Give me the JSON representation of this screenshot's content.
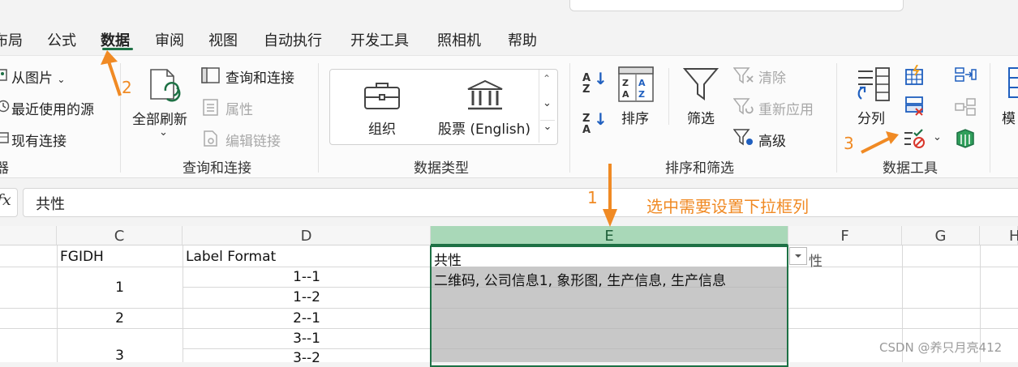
{
  "tabs": [
    "布局",
    "公式",
    "数据",
    "审阅",
    "视图",
    "自动执行",
    "开发工具",
    "照相机",
    "帮助"
  ],
  "ribbon": {
    "get_data": {
      "from_picture": "从图片",
      "recent_sources": "最近使用的源",
      "existing_connections": "现有连接",
      "group_label_tail": "器"
    },
    "queries": {
      "refresh_all": "全部刷新",
      "queries_connections": "查询和连接",
      "properties": "属性",
      "edit_links": "编辑链接",
      "group_label": "查询和连接"
    },
    "data_types": {
      "organization": "组织",
      "stocks": "股票 (English)",
      "group_label": "数据类型"
    },
    "sort_filter": {
      "sort": "排序",
      "filter": "筛选",
      "clear": "清除",
      "reapply": "重新应用",
      "advanced": "高级",
      "group_label": "排序和筛选"
    },
    "data_tools": {
      "text_to_columns": "分列",
      "group_label": "数据工具"
    },
    "cut_off_right": "模"
  },
  "formula_bar": {
    "fx": "fx",
    "value": "共性"
  },
  "columns": [
    "C",
    "D",
    "E",
    "F",
    "G",
    "H"
  ],
  "cells": {
    "C_header": "FGIDH",
    "D_header": "Label Format",
    "E_header": "共性",
    "F_partial": "性",
    "E_row1": "二维码, 公司信息1, 象形图, 生产信息, 生产信息",
    "C_values": [
      "1",
      "2",
      "3"
    ],
    "D_values": [
      "1--1",
      "1--2",
      "2--1",
      "3--1",
      "3--2"
    ]
  },
  "annotations": {
    "n1": "1",
    "n2": "2",
    "n3": "3",
    "note": "选中需要设置下拉框列"
  },
  "watermark": "CSDN @养只月亮412",
  "colors": {
    "accent": "#1e7145",
    "annotation": "#f08a24",
    "selected_col": "#a9d8b8"
  }
}
